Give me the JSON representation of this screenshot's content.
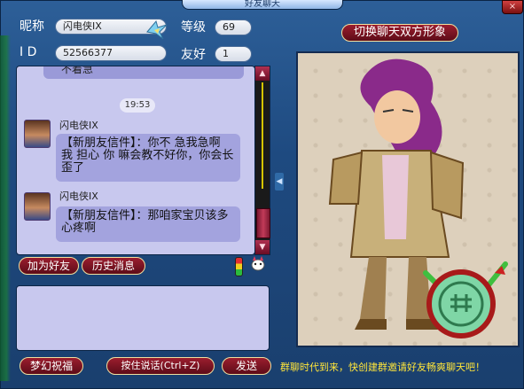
{
  "window": {
    "title": "好友聊天",
    "close_label": "×"
  },
  "profile": {
    "nickname_label": "昵称",
    "nickname_value": "闪电侠IX",
    "level_label": "等级",
    "level_value": "69",
    "id_label": "I D",
    "id_value": "52566377",
    "friendship_label": "友好",
    "friendship_value": "1"
  },
  "toggle_image_button": "切换聊天双方形象",
  "chat": {
    "partial_top": "不着急",
    "time": "19:53",
    "messages": [
      {
        "sender": "闪电侠IX",
        "text": "【新朋友信件】：你不 急我急啊 我 担心 你 嘛会教不好你，你会长歪了"
      },
      {
        "sender": "闪电侠IX",
        "text": "【新朋友信件】：那咱家宝贝该多心疼啊"
      }
    ]
  },
  "buttons": {
    "add_friend": "加为好友",
    "history": "历史消息",
    "blessing": "梦幻祝福",
    "push_to_talk": "按住说话(Ctrl+Z)",
    "send": "发送"
  },
  "notice": "群聊时代到来，快创建群邀请好友畅爽聊天吧！",
  "icons": {
    "wing": "wing-icon",
    "signal": "traffic-light-icon",
    "pet": "pet-icon",
    "jade": "jade-token-icon"
  }
}
